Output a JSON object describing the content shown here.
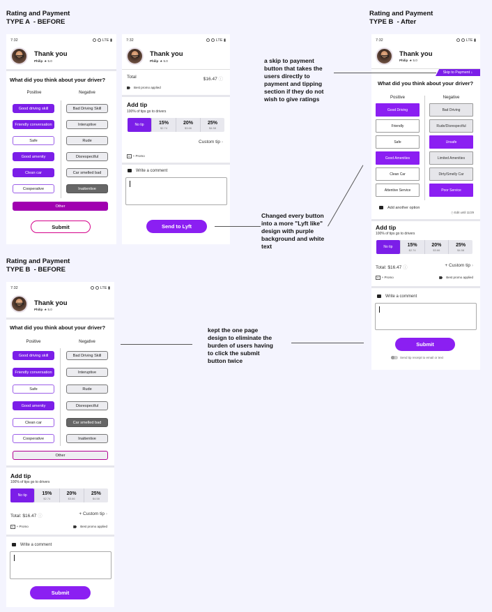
{
  "headings": {
    "a_before": "Rating and Payment\nTYPE A  - BEFORE",
    "b_after": "Rating and Payment\nTYPE B  - After",
    "b_before": "Rating and Payment\nTYPE B  - BEFORE"
  },
  "status_time": "7:32",
  "status_icons": "LTE",
  "driver": {
    "title": "Thank you",
    "name": "Philip",
    "rating": "★ 5.0"
  },
  "question": "What did you think about your driver?",
  "positive_label": "Positive",
  "negative_label": "Negative",
  "typeA": {
    "positive": [
      "Good driving skill",
      "Friendly conversation",
      "Safe",
      "Good amenity",
      "Clean car",
      "Cooperative"
    ],
    "negative": [
      "Bad Driving Skill",
      "Interuptive",
      "Rude",
      "Disrespectful",
      "Car smelled bad",
      "Inattentive"
    ],
    "other": "Other",
    "submit": "Submit"
  },
  "typeB_before": {
    "positive": [
      "Good driving skill",
      "Friendly conversation",
      "Safe",
      "Good amenity",
      "Clean car",
      "Cooperative"
    ],
    "negative": [
      "Bad Driving Skill",
      "Interuptive",
      "Rude",
      "Disrespectful",
      "Car smelled bad",
      "Inattentive"
    ],
    "other": "Other"
  },
  "typeB_after": {
    "skip": "Skip to Payment ↓",
    "positive": [
      "Good Driving",
      "Friendly",
      "Safe",
      "Good Amenities",
      "Clean Car",
      "Attentive Service"
    ],
    "negative": [
      "Bad Driving",
      "Rude/Disrespectful",
      "Unsafe",
      "Limited Amenities",
      "Dirty/Smelly Car",
      "Poor Service"
    ],
    "add_option": "Add another option",
    "edit_until": "Edit until 11/29"
  },
  "payment": {
    "total_label": "Total",
    "total_label_colon": "Total:",
    "total_value": "$16.47",
    "promo_applied": "Best promo applied",
    "promo": "+ Promo",
    "add_tip": "Add tip",
    "tip_note": "100% of tips go to drivers",
    "no_tip": "No tip",
    "tips": [
      {
        "pct": "15%",
        "amt": "$2.74"
      },
      {
        "pct": "20%",
        "amt": "$3.66"
      },
      {
        "pct": "25%",
        "amt": "$4.58"
      }
    ],
    "custom_tip": "Custom tip",
    "custom_tip_plus": "+ Custom tip",
    "comment": "Write a comment",
    "send": "Send to Lyft",
    "submit": "Submit",
    "receipt": "Send tip receipt to email or text"
  },
  "annotations": {
    "skip": "a skip to payment\nbutton that takes the\nusers directly to\npayment and tipping\nsection if they do not\nwish to give ratings",
    "lyft": "Changed every button\ninto a more \"Lyft like\"\ndesign with purple\nbackground and white\ntext",
    "onepage": "kept the one page\ndesign to eliminate the\nburden of users having\nto click the submit\nbutton twice"
  }
}
